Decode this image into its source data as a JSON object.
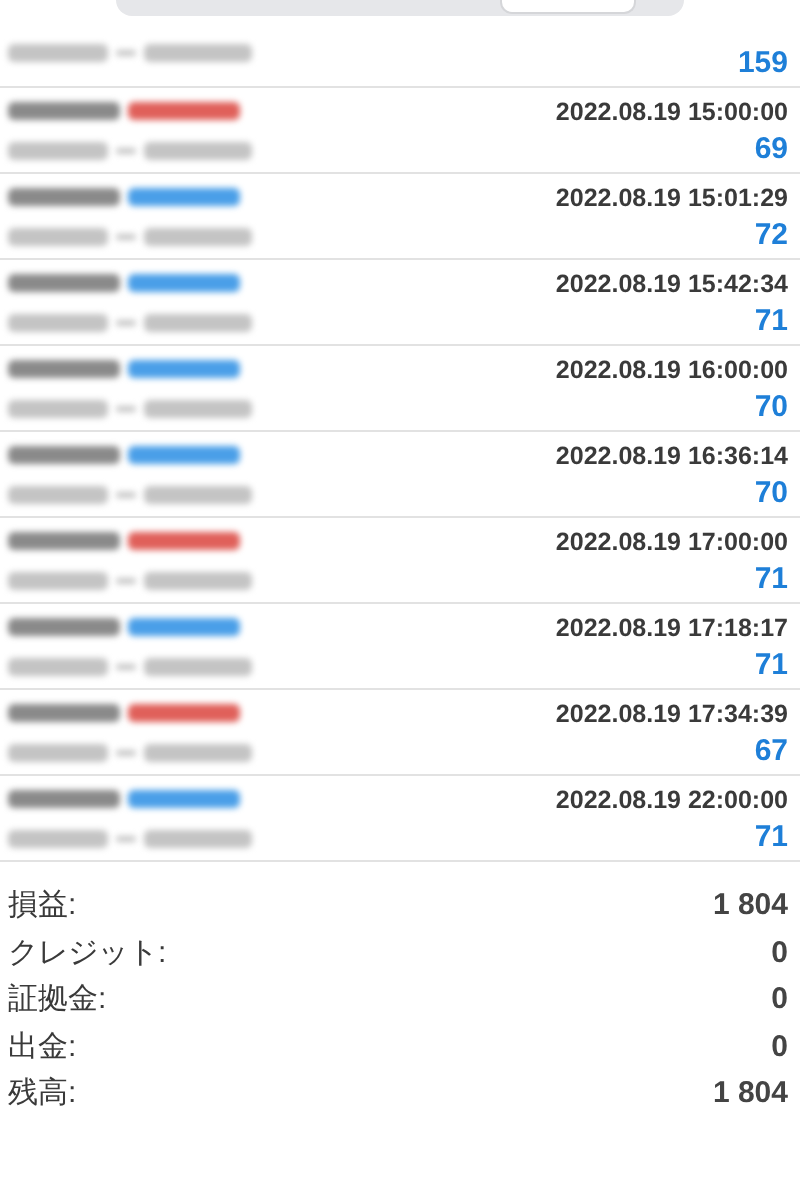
{
  "trades": [
    {
      "profit": "159"
    },
    {
      "color": "#e0605a",
      "time": "2022.08.19 15:00:00",
      "profit": "69"
    },
    {
      "color": "#4a9fe8",
      "time": "2022.08.19 15:01:29",
      "profit": "72"
    },
    {
      "color": "#4a9fe8",
      "time": "2022.08.19 15:42:34",
      "profit": "71"
    },
    {
      "color": "#4a9fe8",
      "time": "2022.08.19 16:00:00",
      "profit": "70"
    },
    {
      "color": "#4a9fe8",
      "time": "2022.08.19 16:36:14",
      "profit": "70"
    },
    {
      "color": "#e0605a",
      "time": "2022.08.19 17:00:00",
      "profit": "71"
    },
    {
      "color": "#4a9fe8",
      "time": "2022.08.19 17:18:17",
      "profit": "71"
    },
    {
      "color": "#e0605a",
      "time": "2022.08.19 17:34:39",
      "profit": "67"
    },
    {
      "color": "#4a9fe8",
      "time": "2022.08.19 22:00:00",
      "profit": "71"
    }
  ],
  "summary": [
    {
      "label": "損益:",
      "value": "1 804"
    },
    {
      "label": "クレジット:",
      "value": "0"
    },
    {
      "label": "証拠金:",
      "value": "0"
    },
    {
      "label": "出金:",
      "value": "0"
    },
    {
      "label": "残高:",
      "value": "1 804"
    }
  ]
}
